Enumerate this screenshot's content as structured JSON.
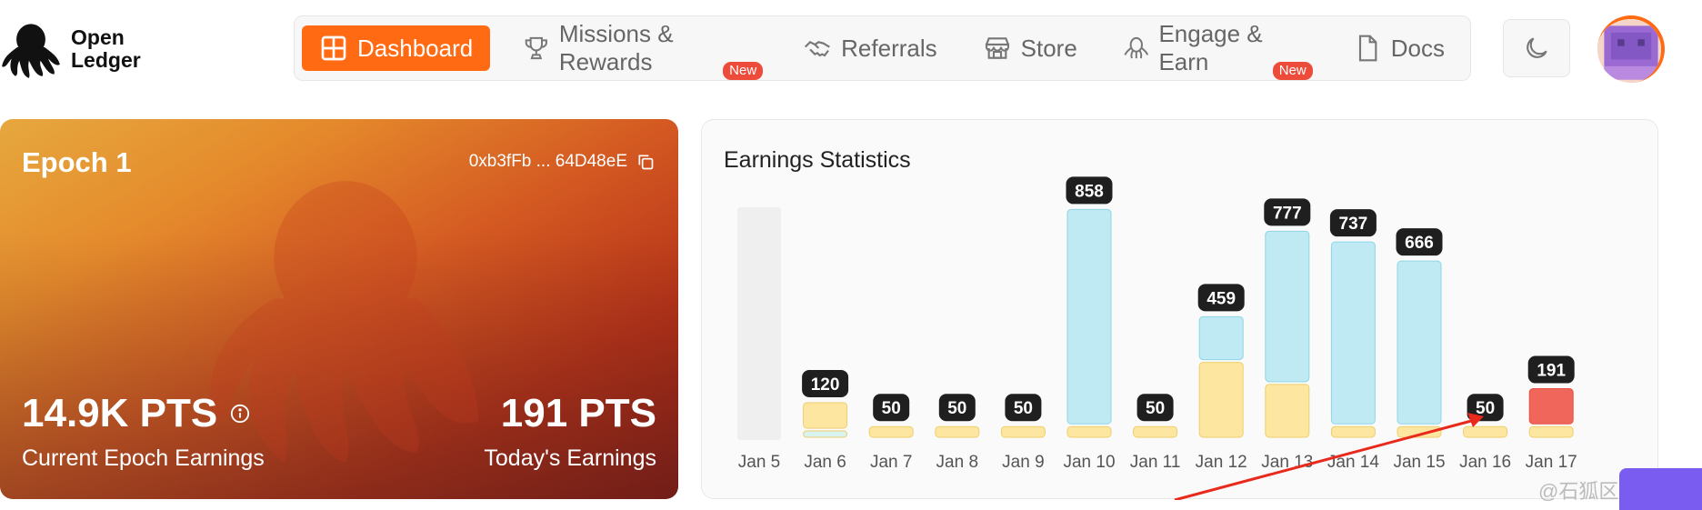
{
  "logo": {
    "line1": "Open",
    "line2": "Ledger"
  },
  "nav": {
    "items": [
      {
        "label": "Dashboard",
        "icon": "grid-icon",
        "active": true,
        "badge": ""
      },
      {
        "label": "Missions & Rewards",
        "icon": "trophy-icon",
        "active": false,
        "badge": "New"
      },
      {
        "label": "Referrals",
        "icon": "handshake-icon",
        "active": false,
        "badge": ""
      },
      {
        "label": "Store",
        "icon": "store-icon",
        "active": false,
        "badge": ""
      },
      {
        "label": "Engage & Earn",
        "icon": "octopus-icon",
        "active": false,
        "badge": "New"
      },
      {
        "label": "Docs",
        "icon": "document-icon",
        "active": false,
        "badge": ""
      }
    ],
    "accent_color": "#ff6a13",
    "badge_color": "#ee4c3a"
  },
  "epoch": {
    "title": "Epoch 1",
    "address": "0xb3fFb ... 64D48eE",
    "current_earnings": "14.9K PTS",
    "current_label": "Current Epoch Earnings",
    "today_earnings": "191 PTS",
    "today_label": "Today's Earnings"
  },
  "earnings": {
    "title": "Earnings Statistics"
  },
  "chart_data": {
    "type": "bar",
    "title": "Earnings Statistics",
    "categories": [
      "Jan 5",
      "Jan 6",
      "Jan 7",
      "Jan 8",
      "Jan 9",
      "Jan 10",
      "Jan 11",
      "Jan 12",
      "Jan 13",
      "Jan 14",
      "Jan 15",
      "Jan 16",
      "Jan 17"
    ],
    "totals": [
      null,
      120,
      50,
      50,
      50,
      858,
      50,
      459,
      777,
      737,
      666,
      50,
      191
    ],
    "series": [
      {
        "values": [
          0,
          15,
          0,
          0,
          0,
          0,
          0,
          0,
          0,
          0,
          0,
          0,
          0
        ],
        "color": "#d9f3f0"
      },
      {
        "values": [
          0,
          105,
          50,
          50,
          50,
          50,
          50,
          289,
          207,
          50,
          50,
          50,
          50
        ],
        "color": "#fde7a0"
      },
      {
        "values": [
          0,
          0,
          0,
          0,
          0,
          808,
          0,
          170,
          570,
          687,
          616,
          0,
          0
        ],
        "color": "#bfeaf3"
      },
      {
        "values": [
          0,
          0,
          0,
          0,
          0,
          0,
          0,
          0,
          0,
          0,
          0,
          0,
          141
        ],
        "color": "#f0665a"
      }
    ],
    "ylim": [
      0,
      900
    ],
    "grid": false,
    "legend": "none"
  },
  "watermark": "@石狐区块链"
}
